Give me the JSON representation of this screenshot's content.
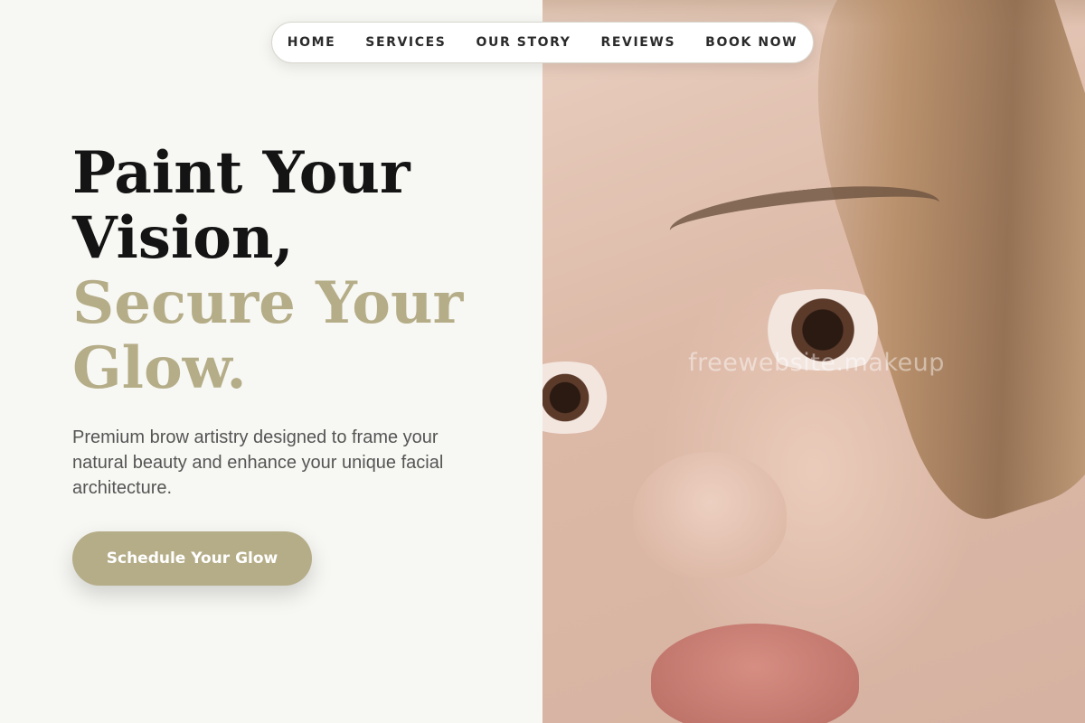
{
  "nav": {
    "items": [
      {
        "label": "HOME"
      },
      {
        "label": "SERVICES"
      },
      {
        "label": "OUR STORY"
      },
      {
        "label": "REVIEWS"
      },
      {
        "label": "BOOK NOW"
      }
    ]
  },
  "hero": {
    "line1": "Paint Your",
    "line2": "Vision,",
    "line3": "Secure Your",
    "line4": "Glow.",
    "description": "Premium brow artistry designed to frame your natural beauty and enhance your unique facial architecture.",
    "cta_label": "Schedule Your Glow"
  },
  "image": {
    "watermark": "freewebsite.makeup"
  },
  "colors": {
    "accent": "#b5ad88",
    "background": "#f7f7f3",
    "heading": "#141414",
    "body_text": "#555555"
  }
}
